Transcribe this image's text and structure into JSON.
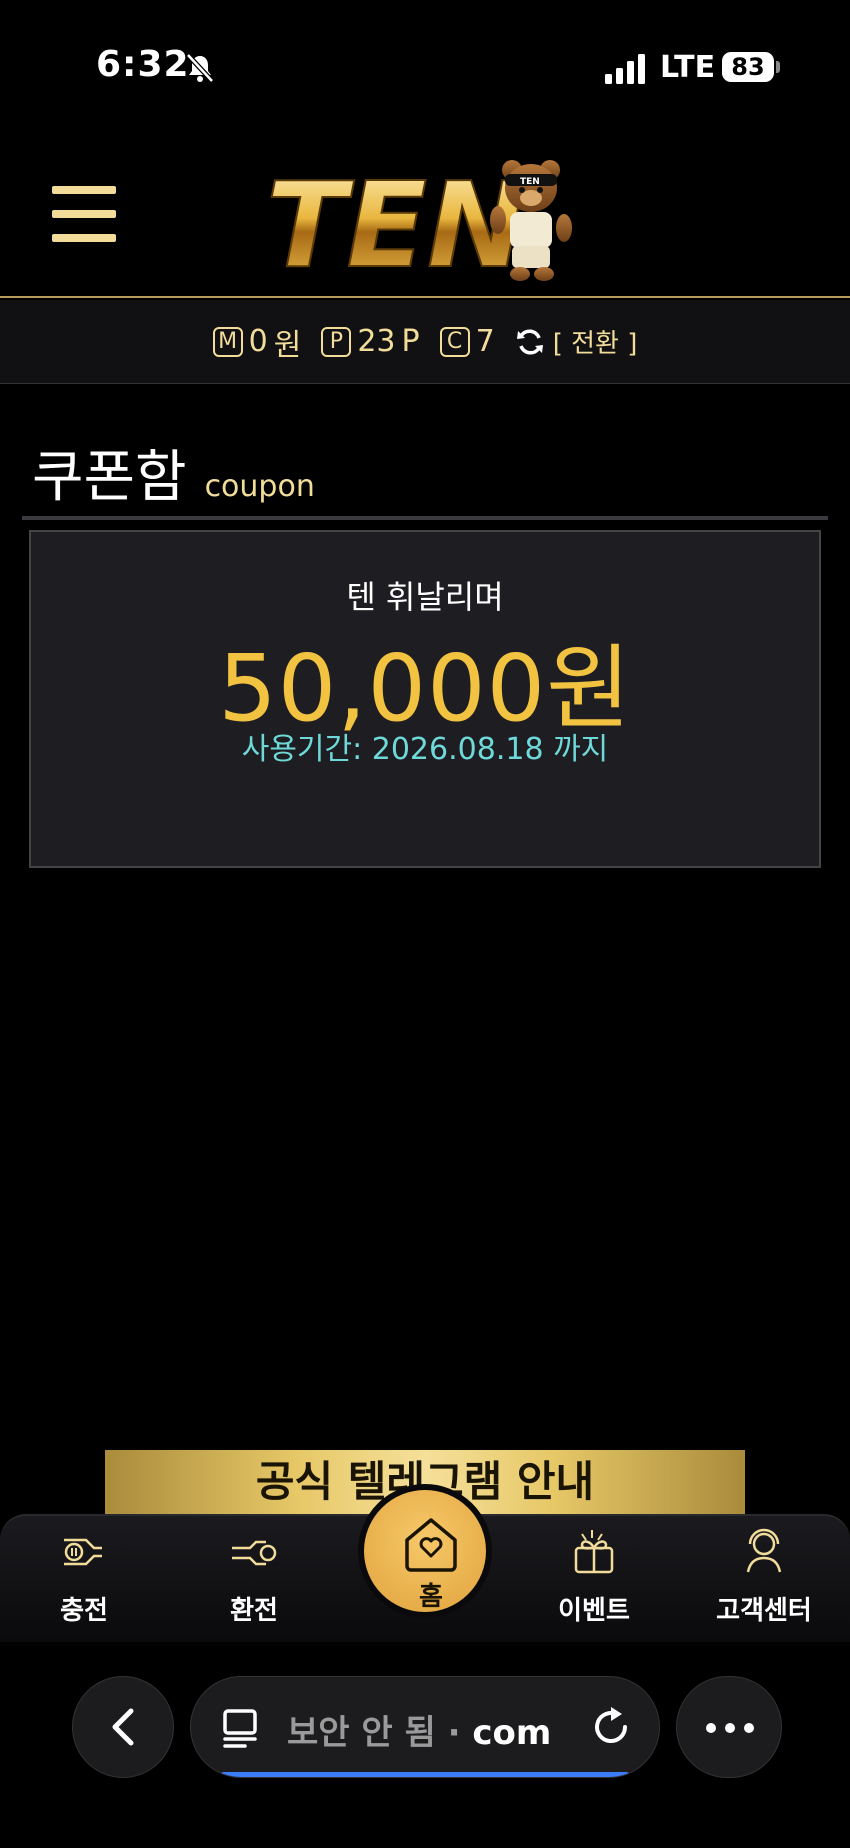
{
  "status_bar": {
    "time": "6:32",
    "lte": "LTE",
    "battery": "83",
    "icons": [
      "bell-slash-icon",
      "signal-icon"
    ]
  },
  "header": {
    "logo_text": "TEN",
    "mascot_badge": "TEN",
    "menu_icon": "hamburger-icon"
  },
  "wallet": {
    "money_badge": "M",
    "money_value": "0",
    "money_unit": "원",
    "point_badge": "P",
    "point_value": "23",
    "point_unit": "P",
    "coupon_badge": "C",
    "coupon_value": "7",
    "switch_label": "[ 전환 ]"
  },
  "section": {
    "title_ko": "쿠폰함",
    "title_en": "coupon"
  },
  "coupon": {
    "name": "텐 휘날리며",
    "amount": "50,000원",
    "expiry": "사용기간: 2026.08.18 까지"
  },
  "banner": {
    "text": "공식 텔레그램 안내"
  },
  "bottom_nav": {
    "items": [
      {
        "label": "충전",
        "icon": "charge-icon"
      },
      {
        "label": "환전",
        "icon": "exchange-icon"
      },
      {
        "label": "홈",
        "icon": "home-heart-icon"
      },
      {
        "label": "이벤트",
        "icon": "gift-icon"
      },
      {
        "label": "고객센터",
        "icon": "support-icon"
      }
    ]
  },
  "browser": {
    "url_prefix": "보안 안 됨 ·",
    "url_domain": "com"
  },
  "colors": {
    "gold": "#f1dc9a",
    "amount": "#f2c241",
    "expiry": "#6fd9d9",
    "home_button": "#e8b04c",
    "url_progress": "#3b7df6"
  }
}
